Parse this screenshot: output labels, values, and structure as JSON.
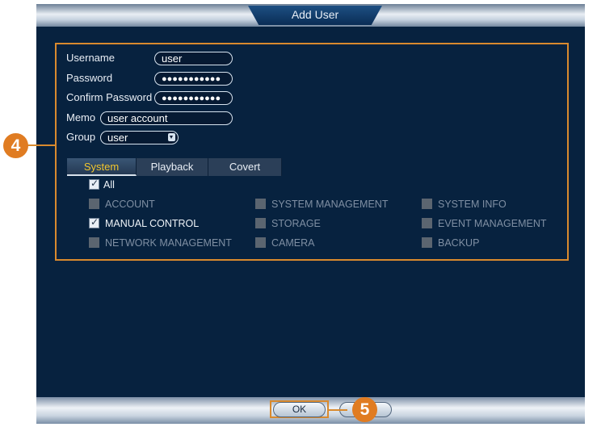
{
  "dialog": {
    "title": "Add User"
  },
  "form": {
    "username_label": "Username",
    "username_value": "user",
    "password_label": "Password",
    "password_value": "●●●●●●●●●●●",
    "confirm_label": "Confirm Password",
    "confirm_value": "●●●●●●●●●●●",
    "memo_label": "Memo",
    "memo_value": "user account",
    "group_label": "Group",
    "group_value": "user"
  },
  "tabs": [
    "System",
    "Playback",
    "Covert"
  ],
  "active_tab": "System",
  "permissions": {
    "all_label": "All",
    "all_checked": true,
    "items": [
      {
        "label": "ACCOUNT",
        "checked": false
      },
      {
        "label": "SYSTEM MANAGEMENT",
        "checked": false
      },
      {
        "label": "SYSTEM INFO",
        "checked": false
      },
      {
        "label": "MANUAL CONTROL",
        "checked": true
      },
      {
        "label": "STORAGE",
        "checked": false
      },
      {
        "label": "EVENT MANAGEMENT",
        "checked": false
      },
      {
        "label": "NETWORK MANAGEMENT",
        "checked": false
      },
      {
        "label": "CAMERA",
        "checked": false
      },
      {
        "label": "BACKUP",
        "checked": false
      }
    ]
  },
  "buttons": {
    "ok": "OK",
    "cancel": ""
  },
  "callouts": {
    "step4": "4",
    "step5": "5"
  },
  "colors": {
    "frame": "#07223f",
    "highlight": "#d98a2e",
    "active_tab": "#f2c62e",
    "callout": "#e07c22"
  }
}
